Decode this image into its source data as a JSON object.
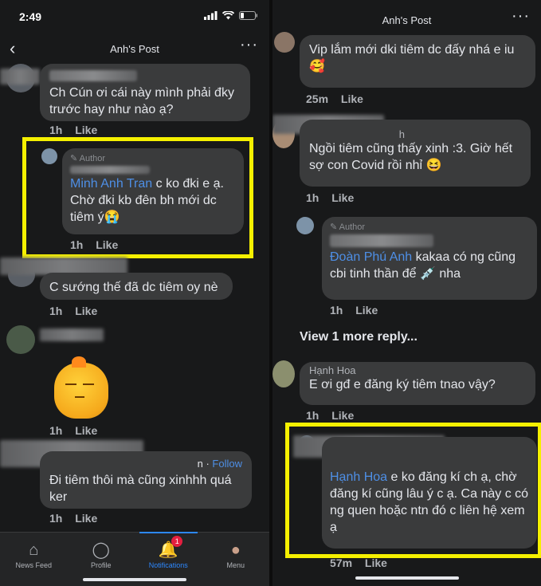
{
  "left": {
    "status_time": "2:49",
    "title": "Anh's Post",
    "comments": [
      {
        "text": "Ch Cún ơi cái này mình phải đky trước hay như nào ạ?",
        "time": "1h",
        "like": "Like"
      },
      {
        "author_tag": "Author",
        "name_partial": "V...",
        "mention": "Minh Anh Tran",
        "text_after": " c ko đki e ạ. Chờ đki kb đên bh mới dc tiêm ý😭",
        "time": "1h",
        "like": "Like"
      },
      {
        "text": "C sướng thế đã dc tiêm oy nè",
        "time": "1h",
        "like": "Like"
      },
      {
        "name_partial": "...g...",
        "sticker": "😑",
        "time": "1h",
        "like": "Like"
      },
      {
        "follow_sep": "n · ",
        "follow": "Follow",
        "text": "Đi tiêm thôi mà cũng xinhhh quá ker",
        "time": "1h",
        "like": "Like"
      }
    ],
    "tabs": [
      {
        "label": "News Feed",
        "icon": "home-icon",
        "glyph": "⌂"
      },
      {
        "label": "Profile",
        "icon": "profile-icon",
        "glyph": "◯"
      },
      {
        "label": "Notifications",
        "icon": "bell-icon",
        "glyph": "🔔",
        "badge": "1"
      },
      {
        "label": "Menu",
        "icon": "menu-avatar-icon",
        "glyph": "●"
      }
    ]
  },
  "right": {
    "title": "Anh's Post",
    "comments": [
      {
        "text": "Vip lắm mới dki tiêm dc đấy nhá e iu 🥰",
        "time": "25m",
        "like": "Like"
      },
      {
        "name_partial": "h",
        "text": "Ngồi tiêm cũng thấy xinh :3. Giờ hết sợ con Covid rồi nhỉ 😆",
        "time": "1h",
        "like": "Like"
      },
      {
        "author_tag": "Author",
        "mention": "Đoàn Phú Anh",
        "text_after": " kakaa có ng cũng cbi tinh thần để 💉 nha",
        "time": "1h",
        "like": "Like"
      },
      {
        "name": "Hạnh Hoa",
        "text": "E ơi gđ e đăng ký tiêm tnao vậy?",
        "time": "1h",
        "like": "Like"
      },
      {
        "mention": "Hạnh Hoa",
        "text_after": " e ko đăng kí ch ạ, chờ đăng kí cũng lâu ý c ạ. Ca này c có ng quen hoặc ntn đó c liên hệ xem ạ",
        "time": "57m",
        "like": "Like"
      }
    ],
    "view_more": "View 1 more reply..."
  },
  "colors": {
    "highlight": "#f5f000",
    "accent": "#2d88ff",
    "mention": "#4e8fe6",
    "bubble": "#3a3b3c"
  }
}
